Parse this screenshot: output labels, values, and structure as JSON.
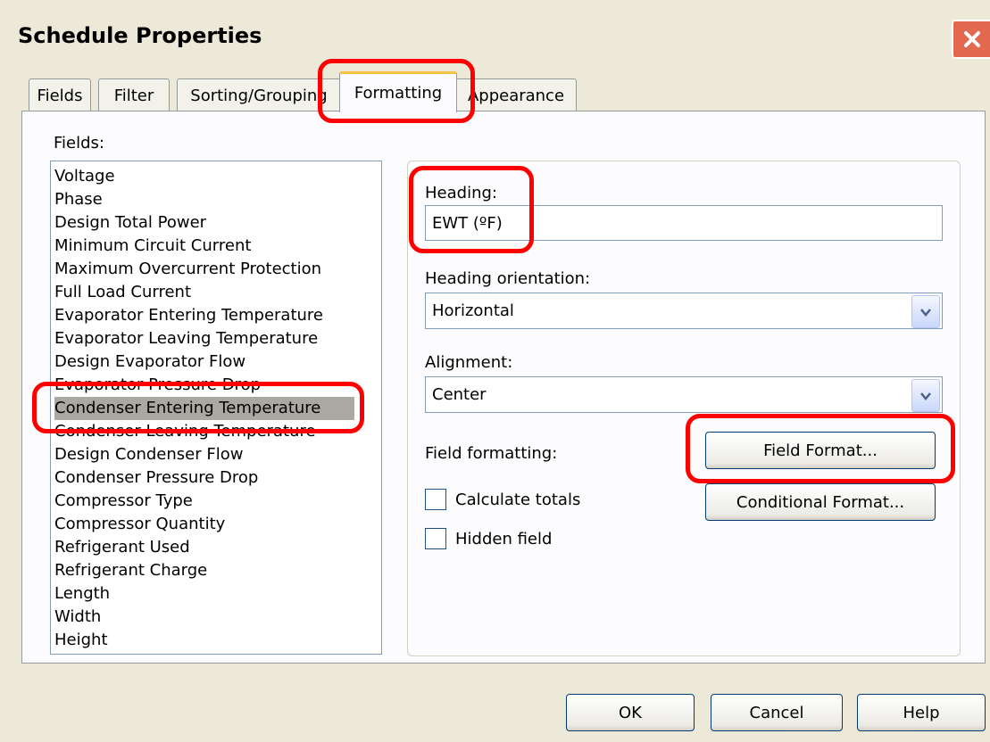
{
  "window": {
    "title": "Schedule Properties"
  },
  "tabs": [
    {
      "label": "Fields"
    },
    {
      "label": "Filter"
    },
    {
      "label": "Sorting/Grouping"
    },
    {
      "label": "Formatting"
    },
    {
      "label": "Appearance"
    }
  ],
  "fields": {
    "label": "Fields:",
    "items": [
      "Voltage",
      "Phase",
      "Design Total Power",
      "Minimum Circuit Current",
      "Maximum Overcurrent Protection",
      "Full Load Current",
      "Evaporator Entering Temperature",
      "Evaporator Leaving Temperature",
      "Design Evaporator Flow",
      "Evaporator Pressure Drop",
      "Condenser Entering Temperature",
      "Condenser Leaving Temperature",
      "Design Condenser Flow",
      "Condenser Pressure Drop",
      "Compressor Type",
      "Compressor Quantity",
      "Refrigerant Used",
      "Refrigerant Charge",
      "Length",
      "Width",
      "Height"
    ],
    "selected": "Condenser Entering Temperature"
  },
  "heading": {
    "label": "Heading:",
    "value": "EWT (ºF)"
  },
  "heading_orientation": {
    "label": "Heading orientation:",
    "value": "Horizontal"
  },
  "alignment": {
    "label": "Alignment:",
    "value": "Center"
  },
  "field_formatting": {
    "label": "Field formatting:"
  },
  "buttons": {
    "field_format": "Field Format...",
    "conditional_format": "Conditional Format...",
    "ok": "OK",
    "cancel": "Cancel",
    "help": "Help"
  },
  "checkboxes": {
    "calculate_totals": {
      "label": "Calculate totals",
      "checked": false
    },
    "hidden_field": {
      "label": "Hidden field",
      "checked": false
    }
  },
  "colors": {
    "highlight": "#ff0000",
    "dialog_bg": "#ece9d8",
    "selection": "#aaa8a0"
  },
  "icons": {
    "close": "close-x-icon",
    "scroll_up": "arrow-up-icon",
    "scroll_down": "arrow-down-icon",
    "dropdown": "chevron-down-icon"
  }
}
